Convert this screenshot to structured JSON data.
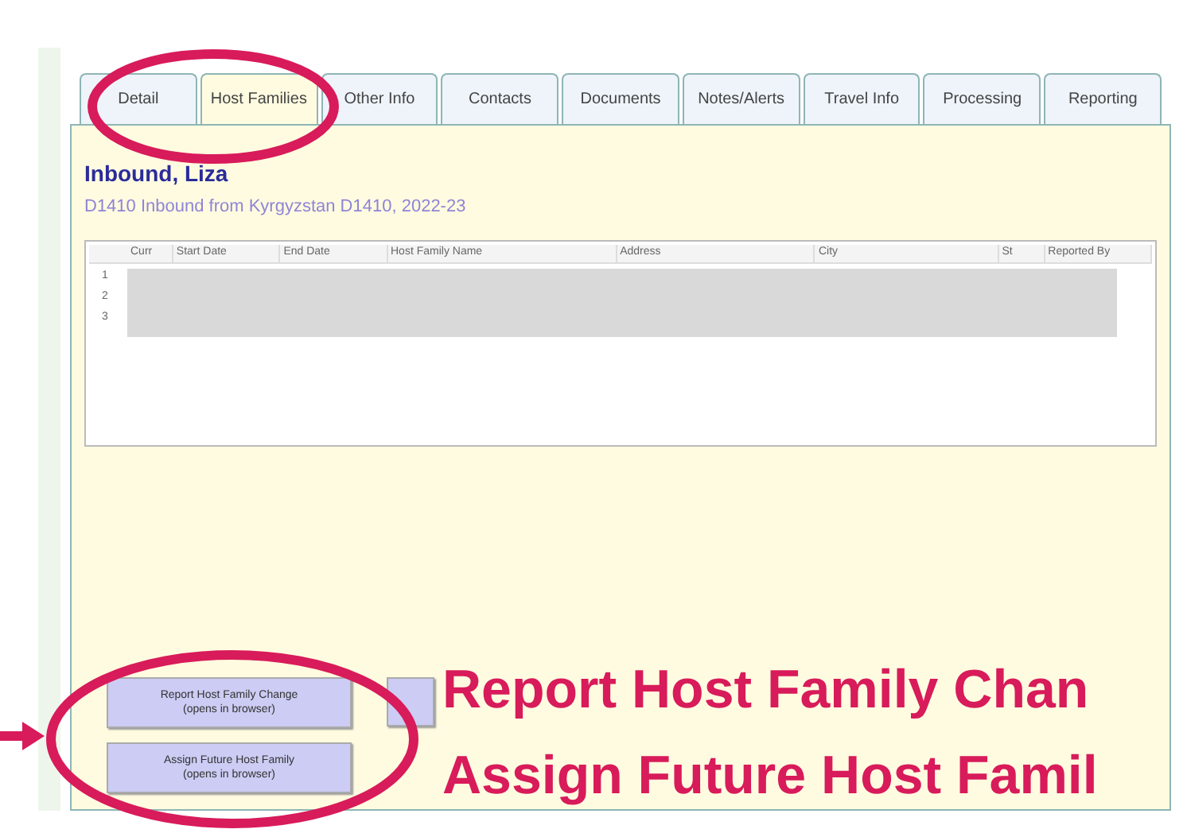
{
  "tabs": [
    {
      "label": "Detail",
      "selected": false
    },
    {
      "label": "Host Families",
      "selected": true
    },
    {
      "label": "Other Info",
      "selected": false
    },
    {
      "label": "Contacts",
      "selected": false
    },
    {
      "label": "Documents",
      "selected": false
    },
    {
      "label": "Notes/Alerts",
      "selected": false
    },
    {
      "label": "Travel Info",
      "selected": false
    },
    {
      "label": "Processing",
      "selected": false
    },
    {
      "label": "Reporting",
      "selected": false
    }
  ],
  "student": {
    "name": "Inbound, Liza",
    "subtitle": "D1410 Inbound from Kyrgyzstan D1410, 2022-23"
  },
  "table": {
    "columns": [
      "Curr",
      "Start Date",
      "End Date",
      "Host Family Name",
      "Address",
      "City",
      "St",
      "Reported By"
    ],
    "row_numbers": [
      "1",
      "2",
      "3"
    ]
  },
  "buttons": [
    {
      "label": "Report Host Family Change",
      "note": "(opens in browser)"
    },
    {
      "label": "Assign Future Host Family",
      "note": "(opens in browser)"
    }
  ],
  "callouts": [
    "Report Host Family Chan",
    "Assign Future Host Famil"
  ]
}
